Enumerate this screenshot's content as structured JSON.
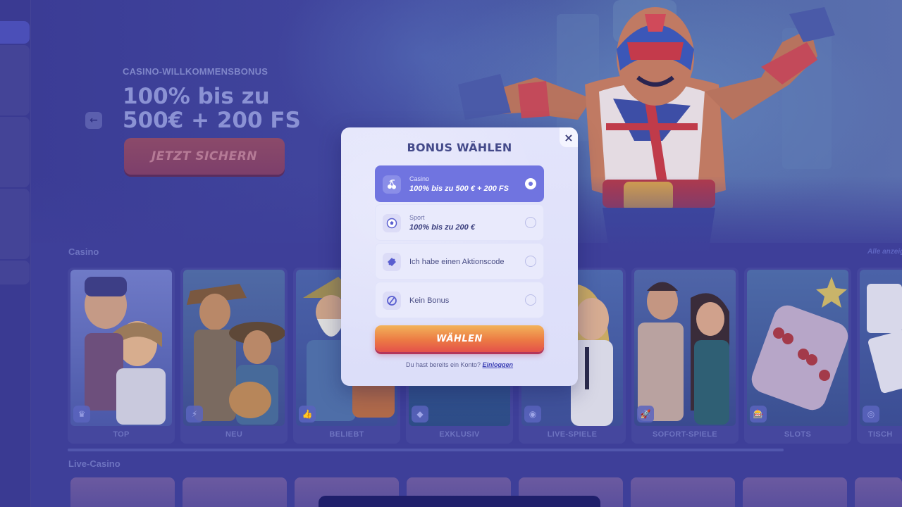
{
  "hero": {
    "label": "CASINO-WILLKOMMENSBONUS",
    "title": "100% bis zu 500€ + 200 FS",
    "cta": "JETZT SICHERN"
  },
  "sections": {
    "casino": "Casino",
    "see_all": "Alle anzeigen",
    "live": "Live-Casino"
  },
  "categories": [
    {
      "label": "TOP",
      "icon": "crown-icon"
    },
    {
      "label": "NEU",
      "icon": "lightning-icon"
    },
    {
      "label": "BELIEBT",
      "icon": "thumbs-up-icon"
    },
    {
      "label": "EXKLUSIV",
      "icon": "diamond-icon"
    },
    {
      "label": "LIVE-SPIELE",
      "icon": "live-icon"
    },
    {
      "label": "SOFORT-SPIELE",
      "icon": "rocket-icon"
    },
    {
      "label": "SLOTS",
      "icon": "slot-machine-icon"
    },
    {
      "label": "TISCH",
      "icon": "chip-icon"
    }
  ],
  "modal": {
    "title": "BONUS WÄHLEN",
    "close": "×",
    "options": [
      {
        "kicker": "Casino",
        "text": "100% bis zu 500 € + 200 FS",
        "icon": "cherries-icon",
        "selected": true
      },
      {
        "kicker": "Sport",
        "text": "100% bis zu 200 €",
        "icon": "football-icon",
        "selected": false
      },
      {
        "text": "Ich habe einen Aktionscode",
        "icon": "ticket-icon",
        "selected": false
      },
      {
        "text": "Kein Bonus",
        "icon": "no-bonus-icon",
        "selected": false
      }
    ],
    "submit": "WÄHLEN",
    "login_prompt": "Du hast bereits ein Konto?",
    "login_link": "Einloggen"
  },
  "colors": {
    "overlay": "#3e3f99",
    "accent": "#7074e0",
    "cta_gradient_start": "#f2b35a",
    "cta_gradient_end": "#e4514a"
  }
}
